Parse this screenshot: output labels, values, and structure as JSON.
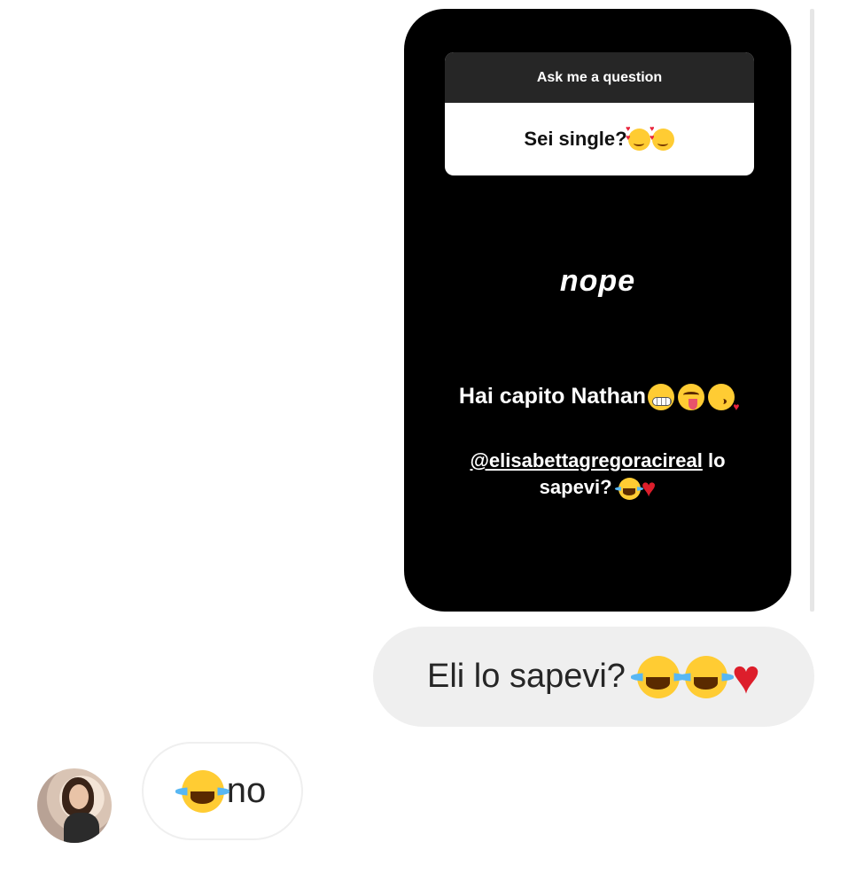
{
  "story": {
    "question_sticker": {
      "header": "Ask me a question",
      "question": "Sei single?",
      "question_emojis": [
        "smiling-face-with-hearts",
        "smiling-face-with-hearts"
      ]
    },
    "answer": "nope",
    "caption_line": "Hai capito Nathan",
    "caption_emojis": [
      "grimacing-face",
      "winking-face-with-tongue",
      "face-blowing-kiss"
    ],
    "mention": "@elisabettagregoracireal",
    "mention_suffix": "lo",
    "mention_line2": "sapevi?",
    "mention_emojis": [
      "face-with-tears-of-joy",
      "red-heart"
    ]
  },
  "messages": {
    "outgoing": {
      "text": "Eli lo sapevi?",
      "emojis": [
        "face-with-tears-of-joy",
        "face-with-tears-of-joy",
        "red-heart"
      ]
    },
    "incoming": {
      "emoji": "face-with-tears-of-joy",
      "text": "no"
    }
  },
  "colors": {
    "story_background": "#000000",
    "sticker_header": "#262626",
    "outgoing_bubble": "#efefef",
    "heart": "#dd1e2b",
    "emoji_yellow": "#ffcc33"
  }
}
